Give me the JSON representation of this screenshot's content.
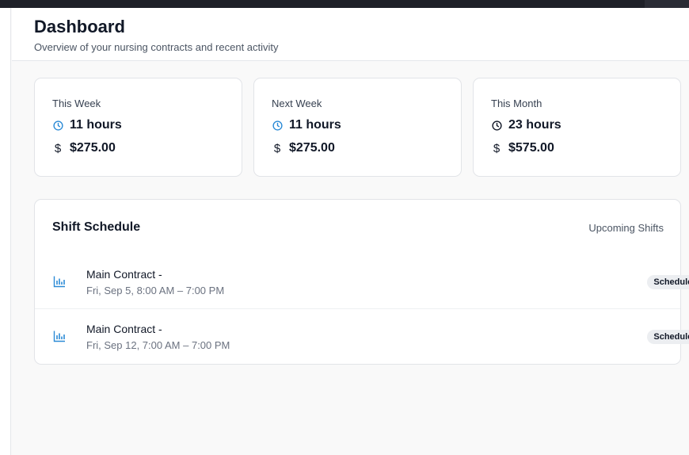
{
  "header": {
    "title": "Dashboard",
    "subtitle": "Overview of your nursing contracts and recent activity"
  },
  "cards": [
    {
      "label": "This Week",
      "hours": "11 hours",
      "amount": "$275.00",
      "icon_color": "#2b8ad6"
    },
    {
      "label": "Next Week",
      "hours": "11 hours",
      "amount": "$275.00",
      "icon_color": "#2b8ad6"
    },
    {
      "label": "This Month",
      "hours": "23 hours",
      "amount": "$575.00",
      "icon_color": "#111827"
    }
  ],
  "schedule": {
    "title": "Shift Schedule",
    "link_label": "Upcoming Shifts",
    "shifts": [
      {
        "name": "Main Contract -",
        "time": "Fri, Sep 5, 8:00 AM – 7:00 PM",
        "status": "Scheduled"
      },
      {
        "name": "Main Contract -",
        "time": "Fri, Sep 12, 7:00 AM – 7:00 PM",
        "status": "Scheduled"
      }
    ]
  },
  "icons": {
    "clock": "clock-icon",
    "dollar": "dollar-icon",
    "bar": "bar-chart-icon"
  },
  "dollar_glyph": "$"
}
